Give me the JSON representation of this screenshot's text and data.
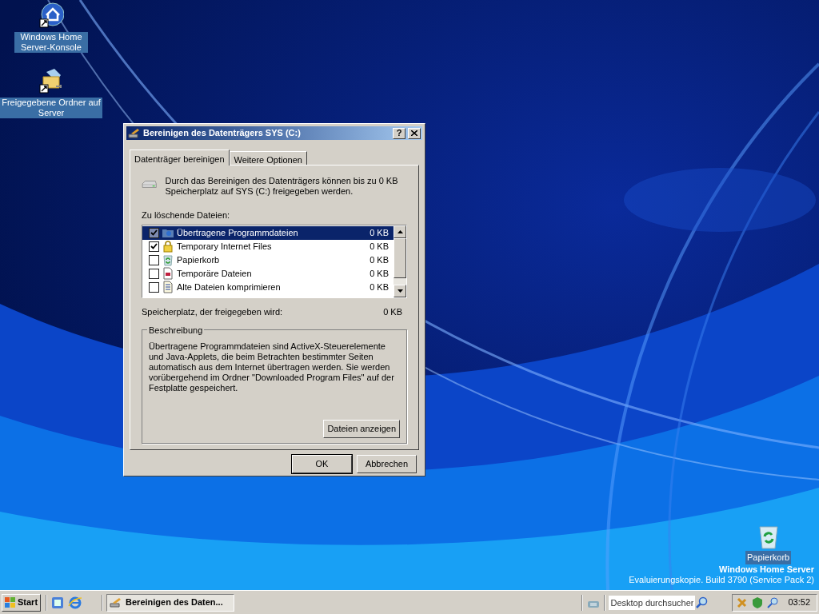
{
  "desktop_icons": [
    {
      "label": "Windows Home Server-Konsole"
    },
    {
      "label": "Freigegebene Ordner auf Server"
    }
  ],
  "recycle_bin": {
    "label": "Papierkorb"
  },
  "branding": {
    "product": "Windows Home Server",
    "build": "Evaluierungskopie. Build 3790 (Service Pack 2)"
  },
  "dialog": {
    "title": "Bereinigen des Datenträgers SYS (C:)",
    "help_button": "?",
    "tabs": [
      {
        "label": "Datenträger bereinigen",
        "selected": true
      },
      {
        "label": "Weitere Optionen",
        "selected": false
      }
    ],
    "intro": "Durch das Bereinigen des Datenträgers können bis zu 0 KB Speicherplatz auf SYS (C:) freigegeben werden.",
    "list_label": "Zu löschende Dateien:",
    "files": [
      {
        "name": "Übertragene Programmdateien",
        "size": "0 KB",
        "checked": true,
        "selected": true
      },
      {
        "name": "Temporary Internet Files",
        "size": "0 KB",
        "checked": true,
        "selected": false
      },
      {
        "name": "Papierkorb",
        "size": "0 KB",
        "checked": false,
        "selected": false
      },
      {
        "name": "Temporäre Dateien",
        "size": "0 KB",
        "checked": false,
        "selected": false
      },
      {
        "name": "Alte Dateien komprimieren",
        "size": "0 KB",
        "checked": false,
        "selected": false
      }
    ],
    "total_label": "Speicherplatz, der freigegeben wird:",
    "total": "0 KB",
    "description": {
      "title": "Beschreibung",
      "text": "Übertragene Programmdateien sind ActiveX-Steuerelemente und Java-Applets, die beim Betrachten bestimmter Seiten automatisch aus dem Internet übertragen werden. Sie werden vorübergehend im Ordner \"Downloaded Program Files\" auf der Festplatte gespeichert.",
      "button": "Dateien anzeigen"
    },
    "buttons": [
      "OK",
      "Abbrechen"
    ]
  },
  "taskbar": {
    "start": "Start",
    "task": "Bereinigen des Daten...",
    "search_placeholder": "Desktop durchsucher",
    "clock": "03:52"
  }
}
